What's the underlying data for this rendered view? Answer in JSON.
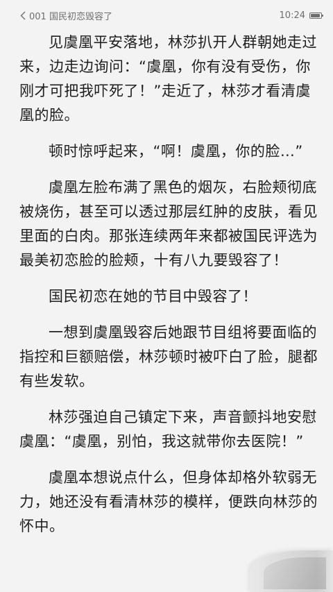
{
  "status_bar": {
    "chapter_title": "001 国民初恋毁容了",
    "time": "10:24"
  },
  "icons": {
    "back": "chevron-left-icon",
    "battery": "battery-icon"
  },
  "paragraphs": [
    "见虞凰平安落地，林莎扒开人群朝她走过来，边走边询问：“虞凰，你有没有受伤，你刚才可把我吓死了！”走近了，林莎才看清虞凰的脸。",
    "顿时惊呼起来，“啊！虞凰，你的脸…”",
    "虞凰左脸布满了黑色的烟灰，右脸颊彻底被烧伤，甚至可以透过那层红肿的皮肤，看见里面的白肉。那张连续两年来都被国民评选为最美初恋脸的脸颊，十有八九要毁容了！",
    "国民初恋在她的节目中毁容了！",
    "一想到虞凰毁容后她跟节目组将要面临的指控和巨额赔偿，林莎顿时被吓白了脸，腿都有些发软。",
    "林莎强迫自己镇定下来，声音颤抖地安慰虞凰：“虞凰，别怕，我这就带你去医院！”",
    "虞凰本想说点什么，但身体却格外软弱无力，她还没有看清林莎的模样，便跌向林莎的怀中。"
  ]
}
